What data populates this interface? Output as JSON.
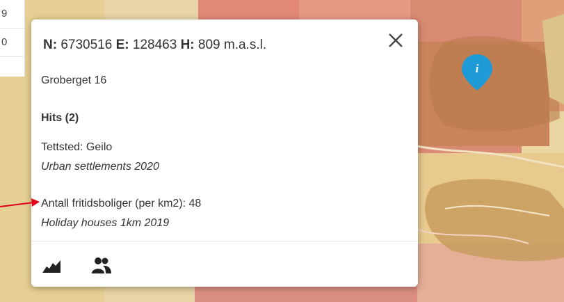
{
  "sidepanel": {
    "row1": "9",
    "row2": "0"
  },
  "popup": {
    "coords_n_label": "N:",
    "coords_n_value": "6730516",
    "coords_e_label": "E:",
    "coords_e_value": "128463",
    "coords_h_label": "H:",
    "coords_h_value": "809 m.a.s.l.",
    "address": "Groberget 16",
    "hits_label": "Hits (2)",
    "results": [
      {
        "title": "Tettsted: Geilo",
        "layer": "Urban settlements 2020"
      },
      {
        "title": "Antall fritidsboliger (per km2): 48",
        "layer": "Holiday houses 1km 2019"
      }
    ]
  },
  "icons": {
    "close": "close-icon",
    "info_pin": "info-pin-icon",
    "elevation": "elevation-profile-icon",
    "population": "population-icon"
  },
  "colors": {
    "annotation_arrow": "#e0001a",
    "info_pin": "#1e9bd7"
  }
}
